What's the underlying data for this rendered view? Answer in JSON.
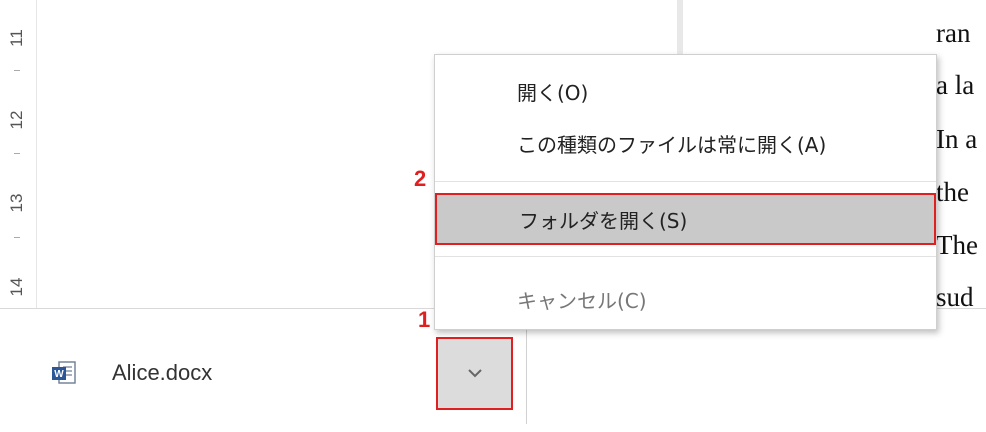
{
  "ruler": {
    "marks": [
      "11",
      "12",
      "13",
      "14"
    ]
  },
  "document": {
    "lines": [
      "ran",
      "a la",
      "In a",
      "the",
      "The",
      "sud"
    ]
  },
  "download": {
    "file_name": "Alice.docx",
    "file_icon": "word-doc-icon",
    "options_icon": "chevron-down-icon"
  },
  "context_menu": {
    "items": [
      {
        "label": "開く(O)",
        "state": "enabled"
      },
      {
        "label": "この種類のファイルは常に開く(A)",
        "state": "enabled"
      },
      {
        "label": "フォルダを開く(S)",
        "state": "highlighted"
      },
      {
        "label": "キャンセル(C)",
        "state": "disabled"
      }
    ]
  },
  "annotations": {
    "step1": "1",
    "step2": "2",
    "color": "#e02020"
  }
}
